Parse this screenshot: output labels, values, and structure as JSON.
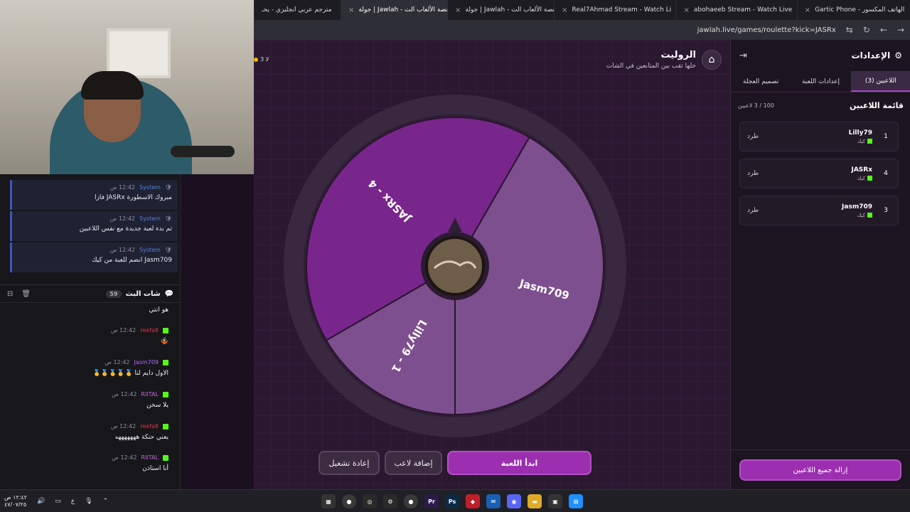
{
  "browser": {
    "tabs": [
      {
        "title": "Gartic Phone - الهاتف المكسور",
        "icon": "gartic-icon"
      },
      {
        "title": "abohaeeb Stream - Watch Live",
        "icon": "kick-icon"
      },
      {
        "title": "Real7Ahmad Stream - Watch Li",
        "icon": "kick-icon"
      },
      {
        "title": "جولة | Jawlah - منصة الألعاب الت",
        "icon": "jawlah-icon"
      },
      {
        "title": "جولة | Jawlah - منصة الألعاب الت",
        "icon": "jawlah-icon",
        "active": true
      },
      {
        "title": "مترجم عربي انجليزي - يحـ",
        "icon": "google-icon"
      }
    ],
    "url": "jawlah.live/games/roulette?kick=JASRx"
  },
  "chat": {
    "system_messages": [
      {
        "name": "System",
        "time": "12:42 ص",
        "text": "مبروك الاسطورة JASRx فازا"
      },
      {
        "name": "System",
        "time": "12:42 ص",
        "text": "تم بدء لعبة جديدة مع نفس اللاعبين"
      },
      {
        "name": "System",
        "time": "12:42 ص",
        "text": "Jasm709 انضم للعبة من كيك"
      }
    ],
    "header": {
      "title": "شات البث",
      "count": "59"
    },
    "messages": [
      {
        "name": "",
        "time": "",
        "text": "هو انتي",
        "color": "#ffffff"
      },
      {
        "name": "reefa8",
        "time": "12:42 ص",
        "text": "🤹",
        "color": "#e0364a"
      },
      {
        "name": "Jasm709",
        "time": "12:42 ص",
        "text": "الاول دايم لنا 🥇🥇🥇🥇🥇",
        "color": "#b06bff"
      },
      {
        "name": "RIITAL",
        "time": "12:42 ص",
        "text": "يلا سخن",
        "color": "#c06bd6"
      },
      {
        "name": "reefa8",
        "time": "12:42 ص",
        "text": "يعني حنكة هههههههه",
        "color": "#e0364a"
      },
      {
        "name": "RIITAL",
        "time": "12:42 ص",
        "text": "أنا استاذن",
        "color": "#c06bd6"
      }
    ]
  },
  "game": {
    "title": "الروليت",
    "subtitle": "خلها تقب بين المتابعين في الشات",
    "online": "3 لا",
    "wheel": {
      "segments": [
        {
          "label": "Jasm709",
          "color": "#7d4f8e",
          "start": -60,
          "end": 90
        },
        {
          "label": "Lilly79 - 1",
          "color": "#7d4f8e",
          "start": 90,
          "end": 150
        },
        {
          "label": "JASRx - 4",
          "color": "#78268c",
          "start": 150,
          "end": 300
        }
      ]
    },
    "buttons": {
      "start": "ابدأ اللعبة",
      "add": "إضافة لاعب",
      "restart": "إعادة تشغيل"
    }
  },
  "settings": {
    "title": "الإعدادات",
    "tabs": [
      "اللاعبين (3)",
      "إعدادات اللعبة",
      "تصميم العجلة"
    ],
    "list_title": "قائمة اللاعبين",
    "list_count": "100 / 3 لاعبين",
    "players": [
      {
        "num": "1",
        "name": "Lilly79",
        "source": "كيك",
        "action": "طرد"
      },
      {
        "num": "4",
        "name": "JASRx",
        "source": "كيك",
        "action": "طرد"
      },
      {
        "num": "3",
        "name": "Jasm709",
        "source": "كيك",
        "action": "طرد"
      }
    ],
    "remove_all": "إزالة جميع اللاعبين"
  },
  "taskbar": {
    "time": "١٢:٤٢ ص",
    "date": "٤٧/٠٧/٢٥",
    "lang": "ع"
  }
}
